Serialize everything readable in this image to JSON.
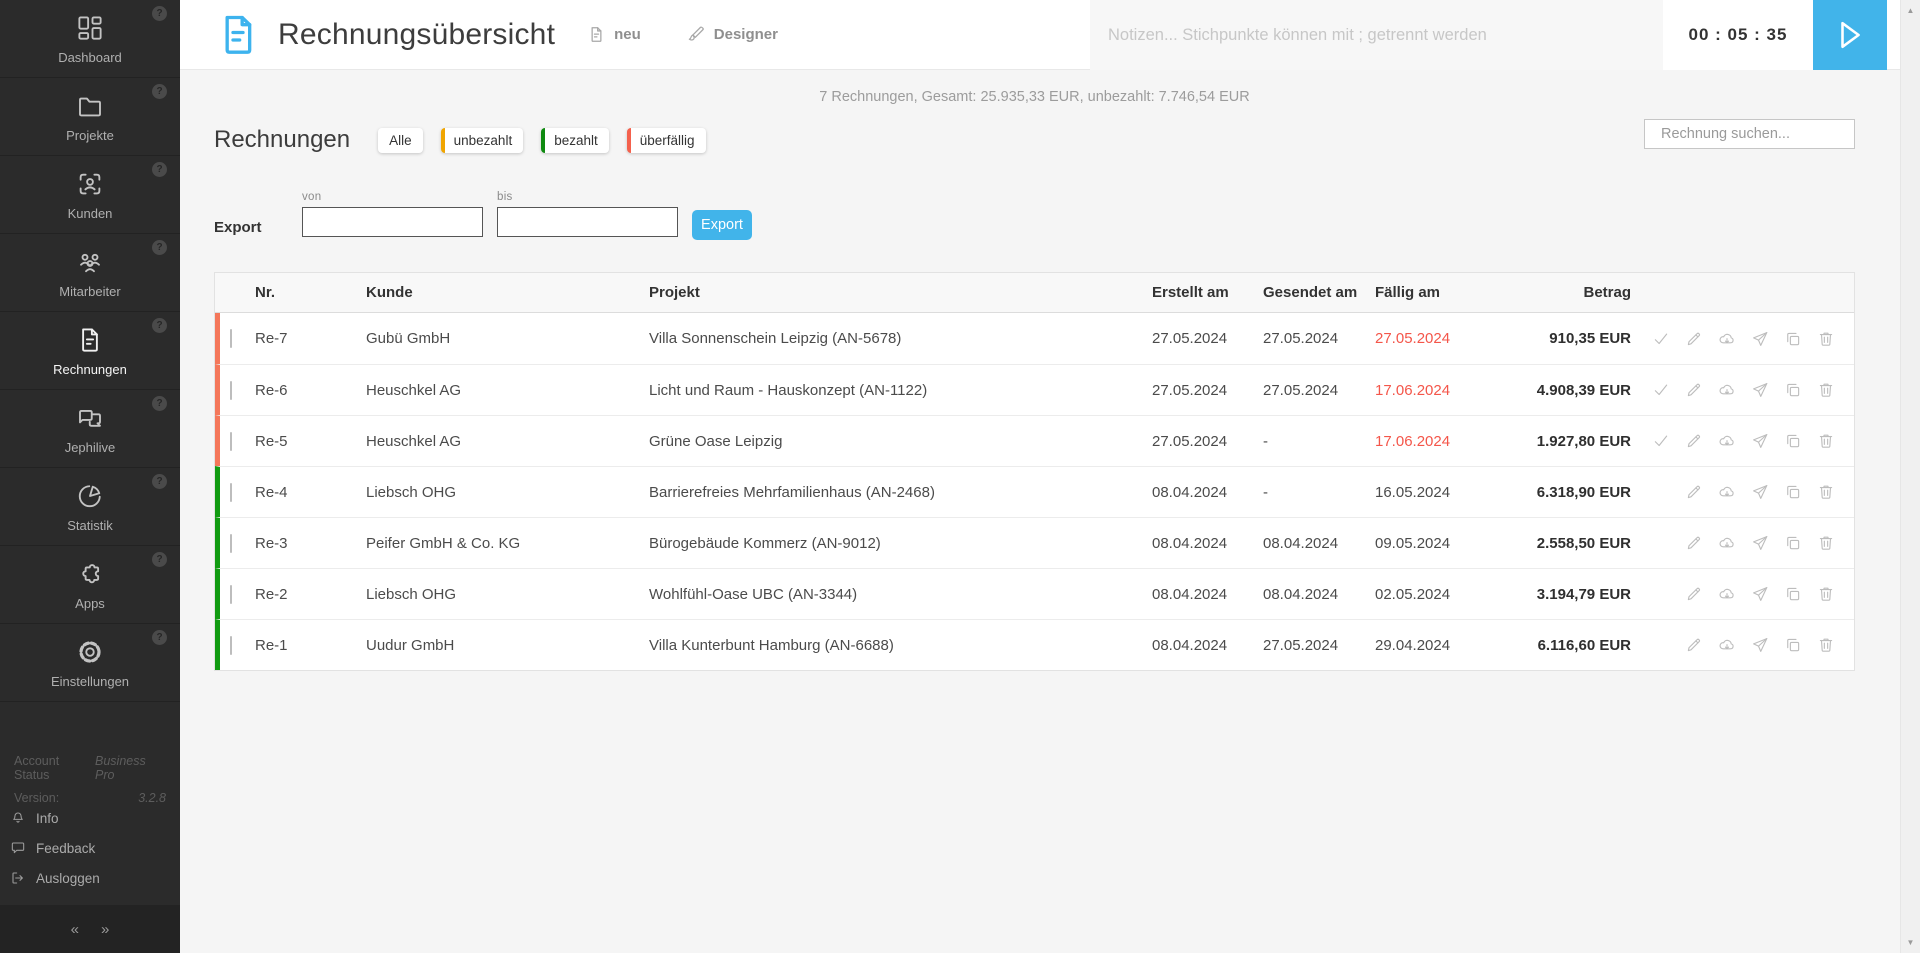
{
  "sidebar": {
    "help_badge": "?",
    "items": [
      {
        "label": "Dashboard",
        "icon": "dashboard-grid-icon"
      },
      {
        "label": "Projekte",
        "icon": "folder-icon"
      },
      {
        "label": "Kunden",
        "icon": "customer-face-icon"
      },
      {
        "label": "Mitarbeiter",
        "icon": "people-group-icon"
      },
      {
        "label": "Rechnungen",
        "icon": "invoice-document-icon"
      },
      {
        "label": "Jephilive",
        "icon": "chat-bubbles-icon"
      },
      {
        "label": "Statistik",
        "icon": "pie-chart-icon"
      },
      {
        "label": "Apps",
        "icon": "puzzle-icon"
      },
      {
        "label": "Einstellungen",
        "icon": "gear-icon"
      }
    ],
    "active_item": "Rechnungen",
    "account_status_label": "Account Status",
    "account_status_value": "Business Pro",
    "version_label": "Version:",
    "version_value": "3.2.8",
    "footer_links": [
      {
        "label": "Info",
        "icon": "bell-icon"
      },
      {
        "label": "Feedback",
        "icon": "speech-bubble-icon"
      },
      {
        "label": "Ausloggen",
        "icon": "logout-icon"
      }
    ],
    "collapse_left": "«",
    "collapse_right": "»"
  },
  "header": {
    "title": "Rechnungsübersicht",
    "title_icon": "invoice-document-icon",
    "neu_label": "neu",
    "designer_label": "Designer",
    "notes_placeholder": "Notizen... Stichpunkte können mit ; getrennt werden",
    "timer_display": "00 : 05 : 35",
    "play_icon": "play-icon"
  },
  "summary": "7 Rechnungen, Gesamt: 25.935,33 EUR, unbezahlt: 7.746,54 EUR",
  "filters": {
    "heading": "Rechnungen",
    "chips": [
      {
        "label": "Alle",
        "color": null
      },
      {
        "label": "unbezahlt",
        "color": "#f0a500"
      },
      {
        "label": "bezahlt",
        "color": "#0f8a10"
      },
      {
        "label": "überfällig",
        "color": "#f4614d"
      }
    ]
  },
  "search": {
    "placeholder": "Rechnung suchen...",
    "icon": "search-icon"
  },
  "export": {
    "label": "Export",
    "von_label": "von",
    "bis_label": "bis",
    "von_value": "",
    "bis_value": "",
    "button_label": "Export"
  },
  "table": {
    "columns": [
      "Nr.",
      "Kunde",
      "Projekt",
      "Erstellt am",
      "Gesendet am",
      "Fällig am",
      "Betrag"
    ],
    "row_actions": [
      "mark-paid-check-icon",
      "edit-pencil-icon",
      "download-cloud-icon",
      "send-plane-icon",
      "duplicate-copy-icon",
      "delete-trash-icon"
    ],
    "rows": [
      {
        "nr": "Re-7",
        "kunde": "Gubü GmbH",
        "projekt": "Villa Sonnenschein Leipzig (AN-5678)",
        "erstellt_am": "27.05.2024",
        "gesendet_am": "27.05.2024",
        "faellig_am": "27.05.2024",
        "faellig_overdue": true,
        "betrag": "910,35 EUR",
        "status": "unbezahlt",
        "has_check_action": true
      },
      {
        "nr": "Re-6",
        "kunde": "Heuschkel AG",
        "projekt": "Licht und Raum - Hauskonzept (AN-1122)",
        "erstellt_am": "27.05.2024",
        "gesendet_am": "27.05.2024",
        "faellig_am": "17.06.2024",
        "faellig_overdue": true,
        "betrag": "4.908,39 EUR",
        "status": "unbezahlt",
        "has_check_action": true
      },
      {
        "nr": "Re-5",
        "kunde": "Heuschkel AG",
        "projekt": "Grüne Oase Leipzig",
        "erstellt_am": "27.05.2024",
        "gesendet_am": "-",
        "faellig_am": "17.06.2024",
        "faellig_overdue": true,
        "betrag": "1.927,80 EUR",
        "status": "unbezahlt",
        "has_check_action": true
      },
      {
        "nr": "Re-4",
        "kunde": "Liebsch OHG",
        "projekt": "Barrierefreies Mehrfamilienhaus (AN-2468)",
        "erstellt_am": "08.04.2024",
        "gesendet_am": "-",
        "faellig_am": "16.05.2024",
        "faellig_overdue": false,
        "betrag": "6.318,90 EUR",
        "status": "bezahlt",
        "has_check_action": false
      },
      {
        "nr": "Re-3",
        "kunde": "Peifer GmbH & Co. KG",
        "projekt": "Bürogebäude Kommerz (AN-9012)",
        "erstellt_am": "08.04.2024",
        "gesendet_am": "08.04.2024",
        "faellig_am": "09.05.2024",
        "faellig_overdue": false,
        "betrag": "2.558,50 EUR",
        "status": "bezahlt",
        "has_check_action": false
      },
      {
        "nr": "Re-2",
        "kunde": "Liebsch OHG",
        "projekt": "Wohlfühl-Oase UBC (AN-3344)",
        "erstellt_am": "08.04.2024",
        "gesendet_am": "08.04.2024",
        "faellig_am": "02.05.2024",
        "faellig_overdue": false,
        "betrag": "3.194,79 EUR",
        "status": "bezahlt",
        "has_check_action": false
      },
      {
        "nr": "Re-1",
        "kunde": "Uudur GmbH",
        "projekt": "Villa Kunterbunt Hamburg (AN-6688)",
        "erstellt_am": "08.04.2024",
        "gesendet_am": "27.05.2024",
        "faellig_am": "29.04.2024",
        "faellig_overdue": false,
        "betrag": "6.116,60 EUR",
        "status": "bezahlt",
        "has_check_action": false
      }
    ]
  },
  "scrollbar": {
    "up": "▲",
    "down": "▼"
  },
  "colors": {
    "accent_blue": "#41b4ea",
    "row_unbezahlt": "#f4775a",
    "row_bezahlt": "#119b11",
    "overdue_text": "#f4564a",
    "sidebar_bg": "#2b2b2b"
  }
}
